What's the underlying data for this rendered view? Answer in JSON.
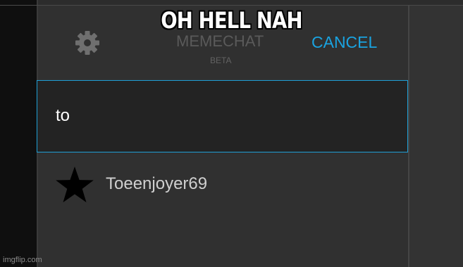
{
  "caption": "OH HELL NAH",
  "header": {
    "settings_icon": "gear-icon",
    "app_name": "MEMECHAT",
    "app_subtitle": "BETA",
    "cancel_label": "CANCEL"
  },
  "search": {
    "value": "to"
  },
  "results": [
    {
      "icon": "star-icon",
      "name": "Toeenjoyer69"
    }
  ],
  "watermark": "imgflip.com",
  "colors": {
    "accent": "#1aa3e0",
    "border_focus": "#1f9fd6",
    "panel_bg": "#303030",
    "input_bg": "#232323",
    "sidebar_bg": "#0f0f0f"
  }
}
